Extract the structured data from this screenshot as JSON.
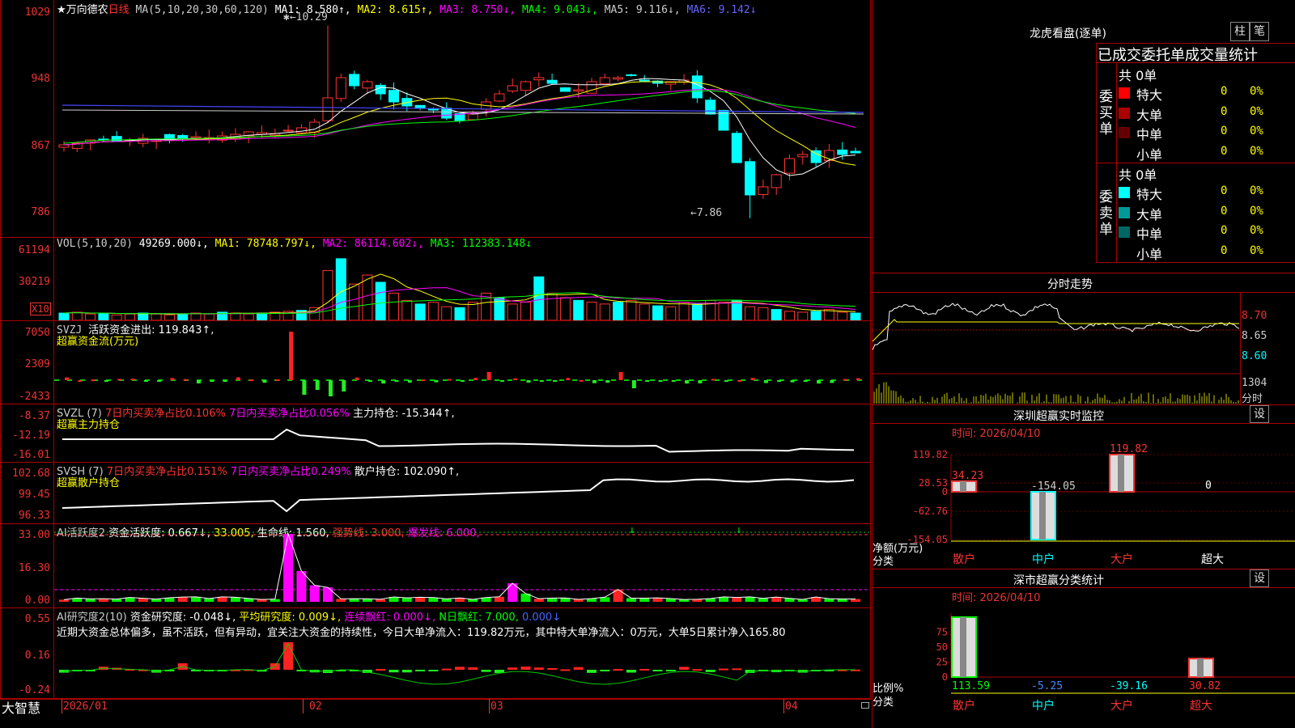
{
  "stock": {
    "name": "★万向德农",
    "period": "日线"
  },
  "kline": {
    "ma_header": "MA(5,10,20,30,60,120)",
    "ma": [
      {
        "label": "MA1: 8.580↑,",
        "color": "#ffffff"
      },
      {
        "label": "MA2: 8.615↑,",
        "color": "#ffff00"
      },
      {
        "label": "MA3: 8.750↓,",
        "color": "#ff00ff"
      },
      {
        "label": "MA4: 9.043↓,",
        "color": "#00ff00"
      },
      {
        "label": "MA5: 9.116↓,",
        "color": "#cccccc"
      },
      {
        "label": "MA6: 9.142↓",
        "color": "#4444ff"
      }
    ],
    "yticks": [
      "1029",
      "948",
      "867",
      "786"
    ],
    "high_label": "10.29",
    "low_label": "7.86"
  },
  "vol": {
    "header": "VOL(5,10,20)",
    "value": "49269.000↓,",
    "ma": [
      "MA1: 78748.797↓,",
      "MA2: 86114.602↓,",
      "MA3: 112383.148↓"
    ],
    "yticks": [
      "61194",
      "30219"
    ],
    "unit": "X10"
  },
  "svzj": {
    "header": "SVZJ",
    "active": "活跃资金进出: 119.843↑,",
    "sub": "超赢资金流(万元)",
    "yticks": [
      "7050",
      "2309",
      "-2433"
    ]
  },
  "svzl": {
    "header": "SVZL (7)",
    "a": "7日内买卖净占比0.106%",
    "b": "7日内买卖净占比0.056%",
    "c": "主力持仓: -15.344↑,",
    "sub": "超赢主力持仓",
    "yticks": [
      "-8.37",
      "-12.19",
      "-16.01"
    ]
  },
  "svsh": {
    "header": "SVSH (7)",
    "a": "7日内买卖净占比0.151%",
    "b": "7日内买卖净占比0.249%",
    "c": "散户持仓: 102.090↑,",
    "sub": "超赢散户持仓",
    "yticks": [
      "102.68",
      "99.45",
      "96.33"
    ]
  },
  "ai1": {
    "header": "AI活跃度2",
    "a": "资金活跃度: 0.667↓,",
    "b": "33.005,",
    "c": "生命线: 1.560,",
    "d": "强势线: 3.000,",
    "e": "爆发线: 6.000,",
    "yticks": [
      "33.00",
      "16.30",
      "0.00"
    ]
  },
  "ai2": {
    "header": "AI研究度2(10)",
    "a": "资金研究度: -0.048↓,",
    "b": "平均研究度: 0.009↓,",
    "c": "连续飘红: 0.000↓,",
    "d": "N日飘红: 7.000,",
    "e": "0.000↓",
    "comment": "近期大资金总体偏多，虽不活跃，但有异动，宜关注大资金的持续性，今日大单净流入：119.82万元，其中特大单净流入：0万元，大单5日累计净入165.80",
    "yticks": [
      "0.55",
      "0.16",
      "-0.24"
    ]
  },
  "xaxis": {
    "labels": [
      "2026/01",
      "02",
      "03",
      "04"
    ]
  },
  "brand": "大智慧",
  "longhu": {
    "title": "龙虎看盘(逐单)",
    "btn1": "柱",
    "btn2": "笔",
    "header": "已成交委托单成交量统计",
    "buy": {
      "side": "委买单",
      "total": "共 0单",
      "rows": [
        {
          "name": "特大",
          "v": "0",
          "p": "0%",
          "color": "#ff0000"
        },
        {
          "name": "大单",
          "v": "0",
          "p": "0%",
          "color": "#aa0000"
        },
        {
          "name": "中单",
          "v": "0",
          "p": "0%",
          "color": "#660000"
        },
        {
          "name": "小单",
          "v": "0",
          "p": "0%",
          "color": "#000000"
        }
      ]
    },
    "sell": {
      "side": "委卖单",
      "total": "共 0单",
      "rows": [
        {
          "name": "特大",
          "v": "0",
          "p": "0%",
          "color": "#00ffff"
        },
        {
          "name": "大单",
          "v": "0",
          "p": "0%",
          "color": "#009999"
        },
        {
          "name": "中单",
          "v": "0",
          "p": "0%",
          "color": "#006666"
        },
        {
          "name": "小单",
          "v": "0",
          "p": "0%",
          "color": "#000000"
        }
      ]
    }
  },
  "fenshi": {
    "title": "分时走势",
    "yticks": [
      "8.70",
      "8.65",
      "8.60"
    ],
    "vol": "1304",
    "unit": "分时"
  },
  "szmon": {
    "title": "深圳超赢实时监控",
    "btn": "设",
    "time": "时间: 2026/04/10",
    "yticks": [
      "119.82",
      "28.53",
      "0",
      "-62.76",
      "-154.05"
    ],
    "ylabel": "净额(万元)",
    "xlabel": "分类",
    "cats": [
      "散户",
      "中户",
      "大户",
      "超大"
    ],
    "values": [
      34.23,
      -154.05,
      119.82,
      0
    ],
    "labels": [
      "34.23",
      "-154.05",
      "119.82",
      "0"
    ]
  },
  "szcls": {
    "title": "深市超赢分类统计",
    "btn": "设",
    "time": "时间: 2026/04/10",
    "yticks": [
      "75",
      "50",
      "25",
      "0"
    ],
    "ylabel": "比例%",
    "xlabel": "分类",
    "cats": [
      "散户",
      "中户",
      "大户",
      "超大"
    ],
    "values": [
      113.59,
      -5.25,
      -39.16,
      30.82
    ],
    "labels": [
      "113.59",
      "-5.25",
      "-39.16",
      "30.82"
    ],
    "label_colors": [
      "#00ff00",
      "#4488ff",
      "#00ffff",
      "#ff3333"
    ]
  }
}
